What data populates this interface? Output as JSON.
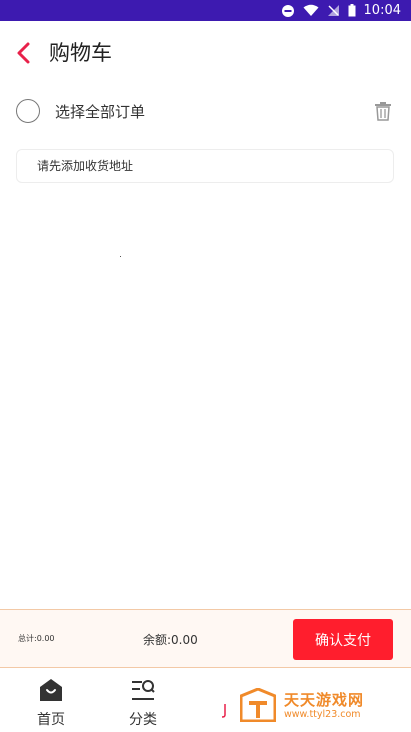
{
  "status_bar": {
    "time": "10:04"
  },
  "header": {
    "title": "购物车"
  },
  "cart": {
    "select_all_label": "选择全部订单"
  },
  "address": {
    "prompt": "请先添加收货地址"
  },
  "payment": {
    "total_label": "总计:0.00",
    "balance_label": "余额:0.00",
    "confirm_label": "确认支付"
  },
  "bottom_nav": {
    "items": [
      {
        "label": "首页",
        "icon": "home-icon"
      },
      {
        "label": "分类",
        "icon": "category-search-icon"
      }
    ]
  },
  "watermark": {
    "title": "天天游戏网",
    "url": "www.ttyl23.com"
  },
  "colors": {
    "status_bar": "#3d1ab0",
    "accent_red": "#ff1e2d",
    "back_arrow": "#e8214a",
    "watermark": "#f08a2a"
  }
}
